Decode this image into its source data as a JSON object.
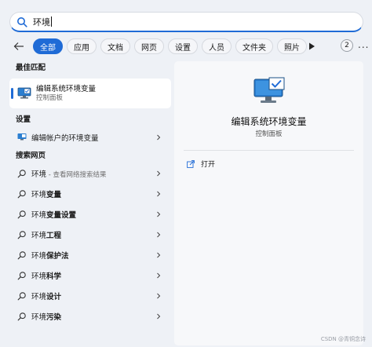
{
  "search": {
    "query": "环境"
  },
  "filters": {
    "items": [
      "全部",
      "应用",
      "文档",
      "网页",
      "设置",
      "人员",
      "文件夹",
      "照片"
    ],
    "active_index": 0,
    "count": "2",
    "more": "..."
  },
  "sections": {
    "best_match": "最佳匹配",
    "settings": "设置",
    "web": "搜索网页"
  },
  "best_match": {
    "title": "编辑系统环境变量",
    "subtitle": "控制面板"
  },
  "settings_item": {
    "label": "编辑帐户的环境变量"
  },
  "web_results": [
    {
      "prefix": "环境",
      "bold": "",
      "sub": " - 查看网络搜索结果"
    },
    {
      "prefix": "环境",
      "bold": "变量",
      "sub": ""
    },
    {
      "prefix": "环境",
      "bold": "变量设置",
      "sub": ""
    },
    {
      "prefix": "环境",
      "bold": "工程",
      "sub": ""
    },
    {
      "prefix": "环境",
      "bold": "保护法",
      "sub": ""
    },
    {
      "prefix": "环境",
      "bold": "科学",
      "sub": ""
    },
    {
      "prefix": "环境",
      "bold": "设计",
      "sub": ""
    },
    {
      "prefix": "环境",
      "bold": "污染",
      "sub": ""
    }
  ],
  "detail": {
    "title": "编辑系统环境变量",
    "subtitle": "控制面板",
    "action": "打开"
  },
  "watermark": "CSDN @青铜念诗",
  "colors": {
    "accent": "#1f6bd6",
    "background": "#eef1f6"
  }
}
